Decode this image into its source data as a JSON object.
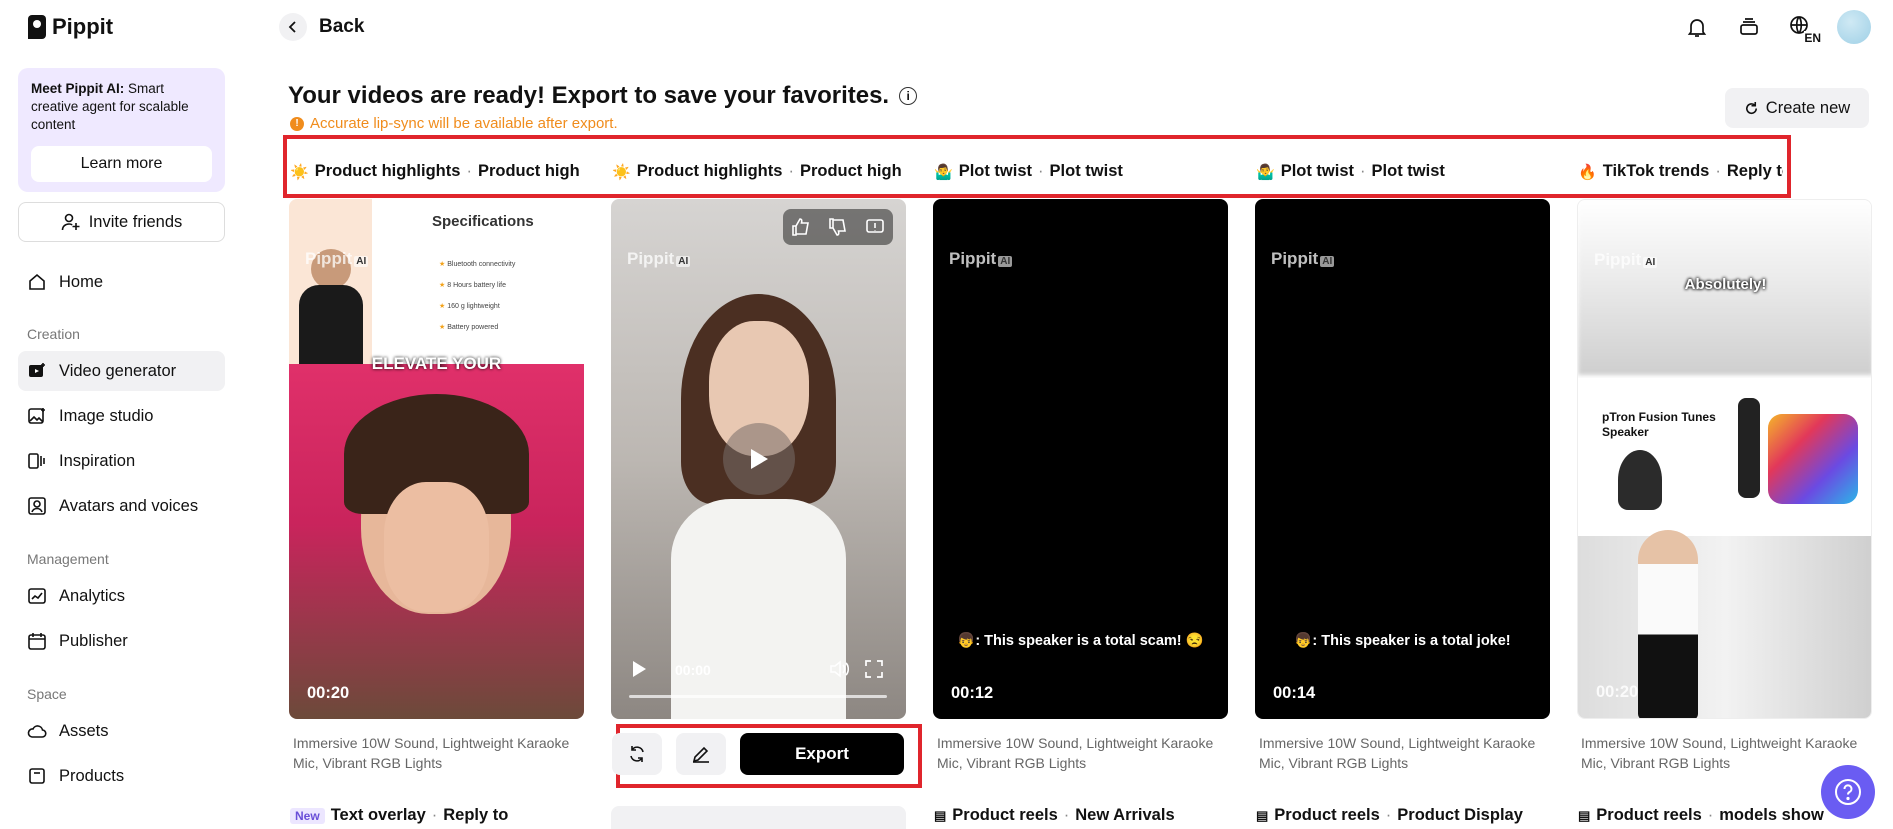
{
  "app": {
    "name": "Pippit"
  },
  "sidebar": {
    "promo_title": "Meet Pippit AI:",
    "promo_body": "Smart creative agent for scalable content",
    "learn_more": "Learn more",
    "invite": "Invite friends",
    "home": "Home",
    "section_creation": "Creation",
    "video_generator": "Video generator",
    "image_studio": "Image studio",
    "inspiration": "Inspiration",
    "avatars_voices": "Avatars and voices",
    "section_management": "Management",
    "analytics": "Analytics",
    "publisher": "Publisher",
    "section_space": "Space",
    "assets": "Assets",
    "products": "Products"
  },
  "topbar": {
    "back": "Back",
    "lang": "EN"
  },
  "header": {
    "title": "Your videos are ready! Export to save your favorites.",
    "warning": "Accurate lip-sync will be available after export.",
    "create_new": "Create new"
  },
  "tabs": [
    {
      "emoji": "☀️",
      "a": "Product highlights",
      "b": "Product highli..."
    },
    {
      "emoji": "☀️",
      "a": "Product highlights",
      "b": "Product highli..."
    },
    {
      "emoji": "🤷‍♂️",
      "a": "Plot twist",
      "b": "Plot twist"
    },
    {
      "emoji": "🤷‍♂️",
      "a": "Plot twist",
      "b": "Plot twist"
    },
    {
      "emoji": "🔥",
      "a": "TikTok trends",
      "b": "Reply to"
    }
  ],
  "cards": [
    {
      "duration": "00:20",
      "heading": "Specifications",
      "overlay": "ELEVATE YOUR",
      "features": [
        "Bluetooth connectivity",
        "8 Hours battery life",
        "160 g lightweight",
        "Battery powered"
      ]
    },
    {
      "time": "00:00"
    },
    {
      "duration": "00:12",
      "caption": "👦: This speaker is a total scam! 😒"
    },
    {
      "duration": "00:14",
      "caption": "👦: This speaker is a total joke!"
    },
    {
      "duration": "00:20",
      "overlay": "Absolutely!",
      "product": "pTron Fusion Tunes Speaker"
    }
  ],
  "watermark": {
    "name": "Pippit",
    "tag": "AI"
  },
  "description": "Immersive 10W Sound, Lightweight Karaoke Mic, Vibrant RGB Lights",
  "actions": {
    "export": "Export"
  },
  "bottom_tags": [
    {
      "badge": "New",
      "a": "Text overlay",
      "b": "Reply to"
    },
    {
      "a": "",
      "b": ""
    },
    {
      "a": "Product reels",
      "b": "New Arrivals"
    },
    {
      "a": "Product reels",
      "b": "Product Display"
    },
    {
      "a": "Product reels",
      "b": "models show"
    }
  ],
  "colors": {
    "accent_red": "#e0252c",
    "warning": "#f08c1c",
    "promo_bg": "#efe9ff",
    "help": "#6a5cf2"
  }
}
